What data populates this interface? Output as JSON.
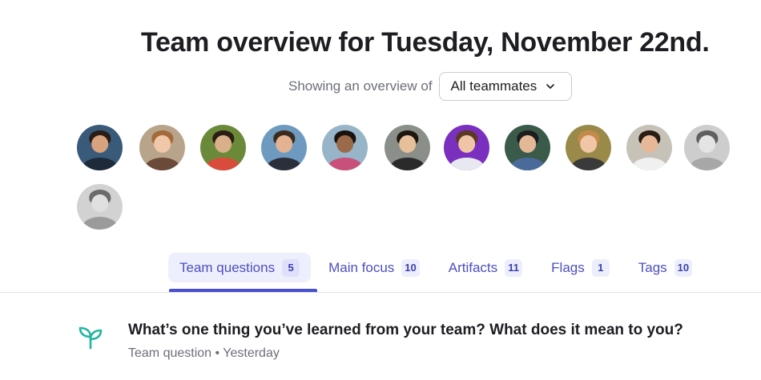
{
  "header": {
    "title": "Team overview for Tuesday, November 22nd.",
    "filter_label": "Showing an overview of",
    "filter_value": "All teammates"
  },
  "avatars": [
    {
      "name": "teammate-1",
      "bg": "#3a5a7a",
      "skin": "#d9a27f",
      "hair": "#2a1d16",
      "shirt": "#1e2a3a",
      "gray": false
    },
    {
      "name": "teammate-2",
      "bg": "#b7a48b",
      "skin": "#f0c7a8",
      "hair": "#a56a3a",
      "shirt": "#6b4a3a",
      "gray": false
    },
    {
      "name": "teammate-3",
      "bg": "#6a8a3a",
      "skin": "#d9b08a",
      "hair": "#2b1e14",
      "shirt": "#d94b3a",
      "gray": false
    },
    {
      "name": "teammate-4",
      "bg": "#6f9ac0",
      "skin": "#e2b293",
      "hair": "#3b2a1e",
      "shirt": "#2a2f3a",
      "gray": false
    },
    {
      "name": "teammate-5",
      "bg": "#98b4c8",
      "skin": "#9a6a4a",
      "hair": "#1a120d",
      "shirt": "#c8507a",
      "gray": false
    },
    {
      "name": "teammate-6",
      "bg": "#8a8f8a",
      "skin": "#e6c09a",
      "hair": "#1e1610",
      "shirt": "#2a2a2a",
      "gray": false
    },
    {
      "name": "teammate-7",
      "bg": "#7a2fbf",
      "skin": "#f0c4a6",
      "hair": "#5a3a22",
      "shirt": "#e8e8f0",
      "gray": false
    },
    {
      "name": "teammate-8",
      "bg": "#3a5a4a",
      "skin": "#e3b896",
      "hair": "#1d1d1d",
      "shirt": "#4a6a9a",
      "gray": false
    },
    {
      "name": "teammate-9",
      "bg": "#9a8a4a",
      "skin": "#f0c6a6",
      "hair": "#c48a4a",
      "shirt": "#3a3a3a",
      "gray": false
    },
    {
      "name": "teammate-10",
      "bg": "#c7c2b8",
      "skin": "#e6b898",
      "hair": "#2a1d14",
      "shirt": "#f0f0f0",
      "gray": false
    },
    {
      "name": "teammate-11",
      "bg": "#bdbdbd",
      "skin": "#dcdcdc",
      "hair": "#2a2a2a",
      "shirt": "#8a8a8a",
      "gray": true
    },
    {
      "name": "teammate-12",
      "bg": "#c4c4c4",
      "skin": "#d6d6d6",
      "hair": "#3a3a3a",
      "shirt": "#7a7a7a",
      "gray": true
    }
  ],
  "tabs": [
    {
      "label": "Team questions",
      "count": "5",
      "active": true
    },
    {
      "label": "Main focus",
      "count": "10",
      "active": false
    },
    {
      "label": "Artifacts",
      "count": "11",
      "active": false
    },
    {
      "label": "Flags",
      "count": "1",
      "active": false
    },
    {
      "label": "Tags",
      "count": "10",
      "active": false
    }
  ],
  "question": {
    "icon": "sprout-icon",
    "title": "What’s one thing you’ve learned from your team? What does it mean to you?",
    "meta": "Team question • Yesterday"
  },
  "colors": {
    "accent": "#4a4fd0",
    "tab_text": "#4b4fbf",
    "sprout": "#23b5a0"
  }
}
